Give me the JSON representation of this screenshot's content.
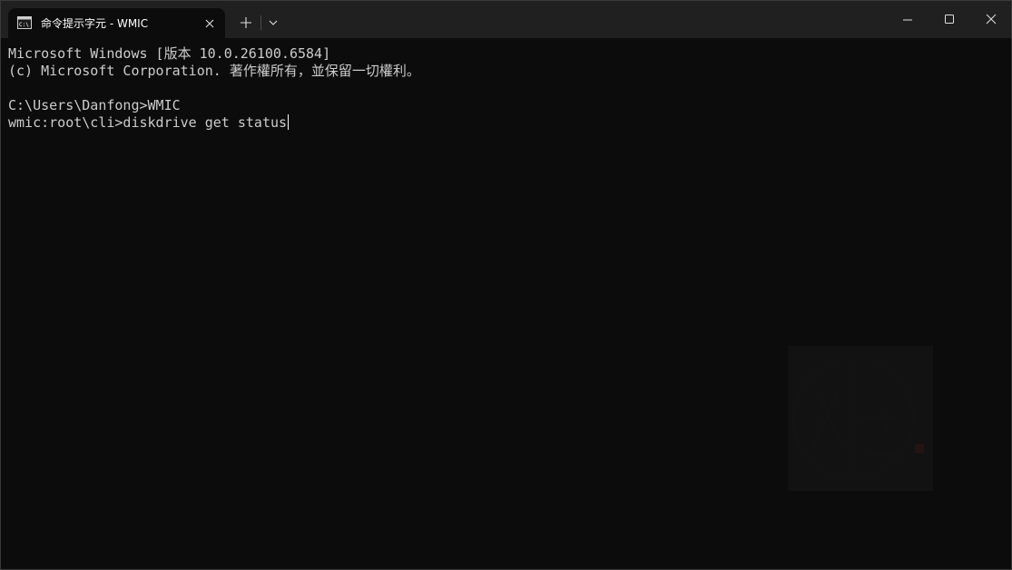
{
  "window": {
    "tab_title": "命令提示字元 - WMIC",
    "tab_icon": "command-prompt-icon"
  },
  "terminal": {
    "lines": [
      "Microsoft Windows [版本 10.0.26100.6584]",
      "(c) Microsoft Corporation. 著作權所有，並保留一切權利。",
      "",
      "C:\\Users\\Danfong>WMIC",
      "wmic:root\\cli>diskdrive get status"
    ]
  },
  "colors": {
    "background": "#0c0c0c",
    "titlebar": "#202020",
    "text": "#cccccc"
  }
}
